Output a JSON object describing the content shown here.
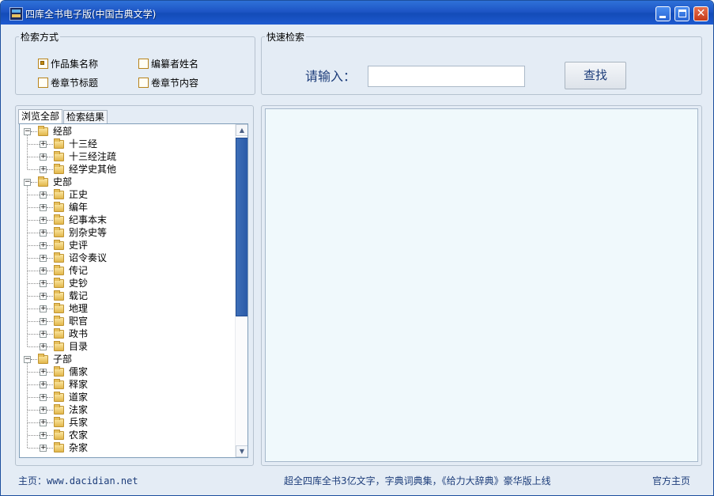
{
  "window": {
    "title": "四库全书电子版(中国古典文学)"
  },
  "search_method": {
    "legend": "检索方式",
    "options": [
      {
        "label": "作品集名称",
        "checked": true
      },
      {
        "label": "编纂者姓名",
        "checked": false
      },
      {
        "label": "卷章节标题",
        "checked": false
      },
      {
        "label": "卷章节内容",
        "checked": false
      }
    ]
  },
  "quick_search": {
    "legend": "快速检索",
    "prompt": "请输入：",
    "value": "",
    "button": "查找"
  },
  "tabs": [
    {
      "label": "浏览全部",
      "active": true
    },
    {
      "label": "检索结果",
      "active": false
    }
  ],
  "tree": [
    {
      "label": "经部",
      "level": 0,
      "expanded": true
    },
    {
      "label": "十三经",
      "level": 1
    },
    {
      "label": "十三经注疏",
      "level": 1
    },
    {
      "label": "经学史其他",
      "level": 1
    },
    {
      "label": "史部",
      "level": 0,
      "expanded": true
    },
    {
      "label": "正史",
      "level": 1
    },
    {
      "label": "编年",
      "level": 1
    },
    {
      "label": "纪事本末",
      "level": 1
    },
    {
      "label": "别杂史等",
      "level": 1
    },
    {
      "label": "史评",
      "level": 1
    },
    {
      "label": "诏令奏议",
      "level": 1
    },
    {
      "label": "传记",
      "level": 1
    },
    {
      "label": "史钞",
      "level": 1
    },
    {
      "label": "载记",
      "level": 1
    },
    {
      "label": "地理",
      "level": 1
    },
    {
      "label": "职官",
      "level": 1
    },
    {
      "label": "政书",
      "level": 1
    },
    {
      "label": "目录",
      "level": 1
    },
    {
      "label": "子部",
      "level": 0,
      "expanded": true
    },
    {
      "label": "儒家",
      "level": 1
    },
    {
      "label": "释家",
      "level": 1
    },
    {
      "label": "道家",
      "level": 1
    },
    {
      "label": "法家",
      "level": 1
    },
    {
      "label": "兵家",
      "level": 1
    },
    {
      "label": "农家",
      "level": 1
    },
    {
      "label": "杂家",
      "level": 1
    }
  ],
  "status": {
    "home": "主页：www.dacidian.net",
    "promo": "超全四库全书3亿文字，字典词典集，《给力大辞典》豪华版上线",
    "official": "官方主页"
  },
  "colors": {
    "titlebar": "#1d55c5",
    "accent_text": "#1d3d7a",
    "result_bg": "#f0f9fc"
  }
}
